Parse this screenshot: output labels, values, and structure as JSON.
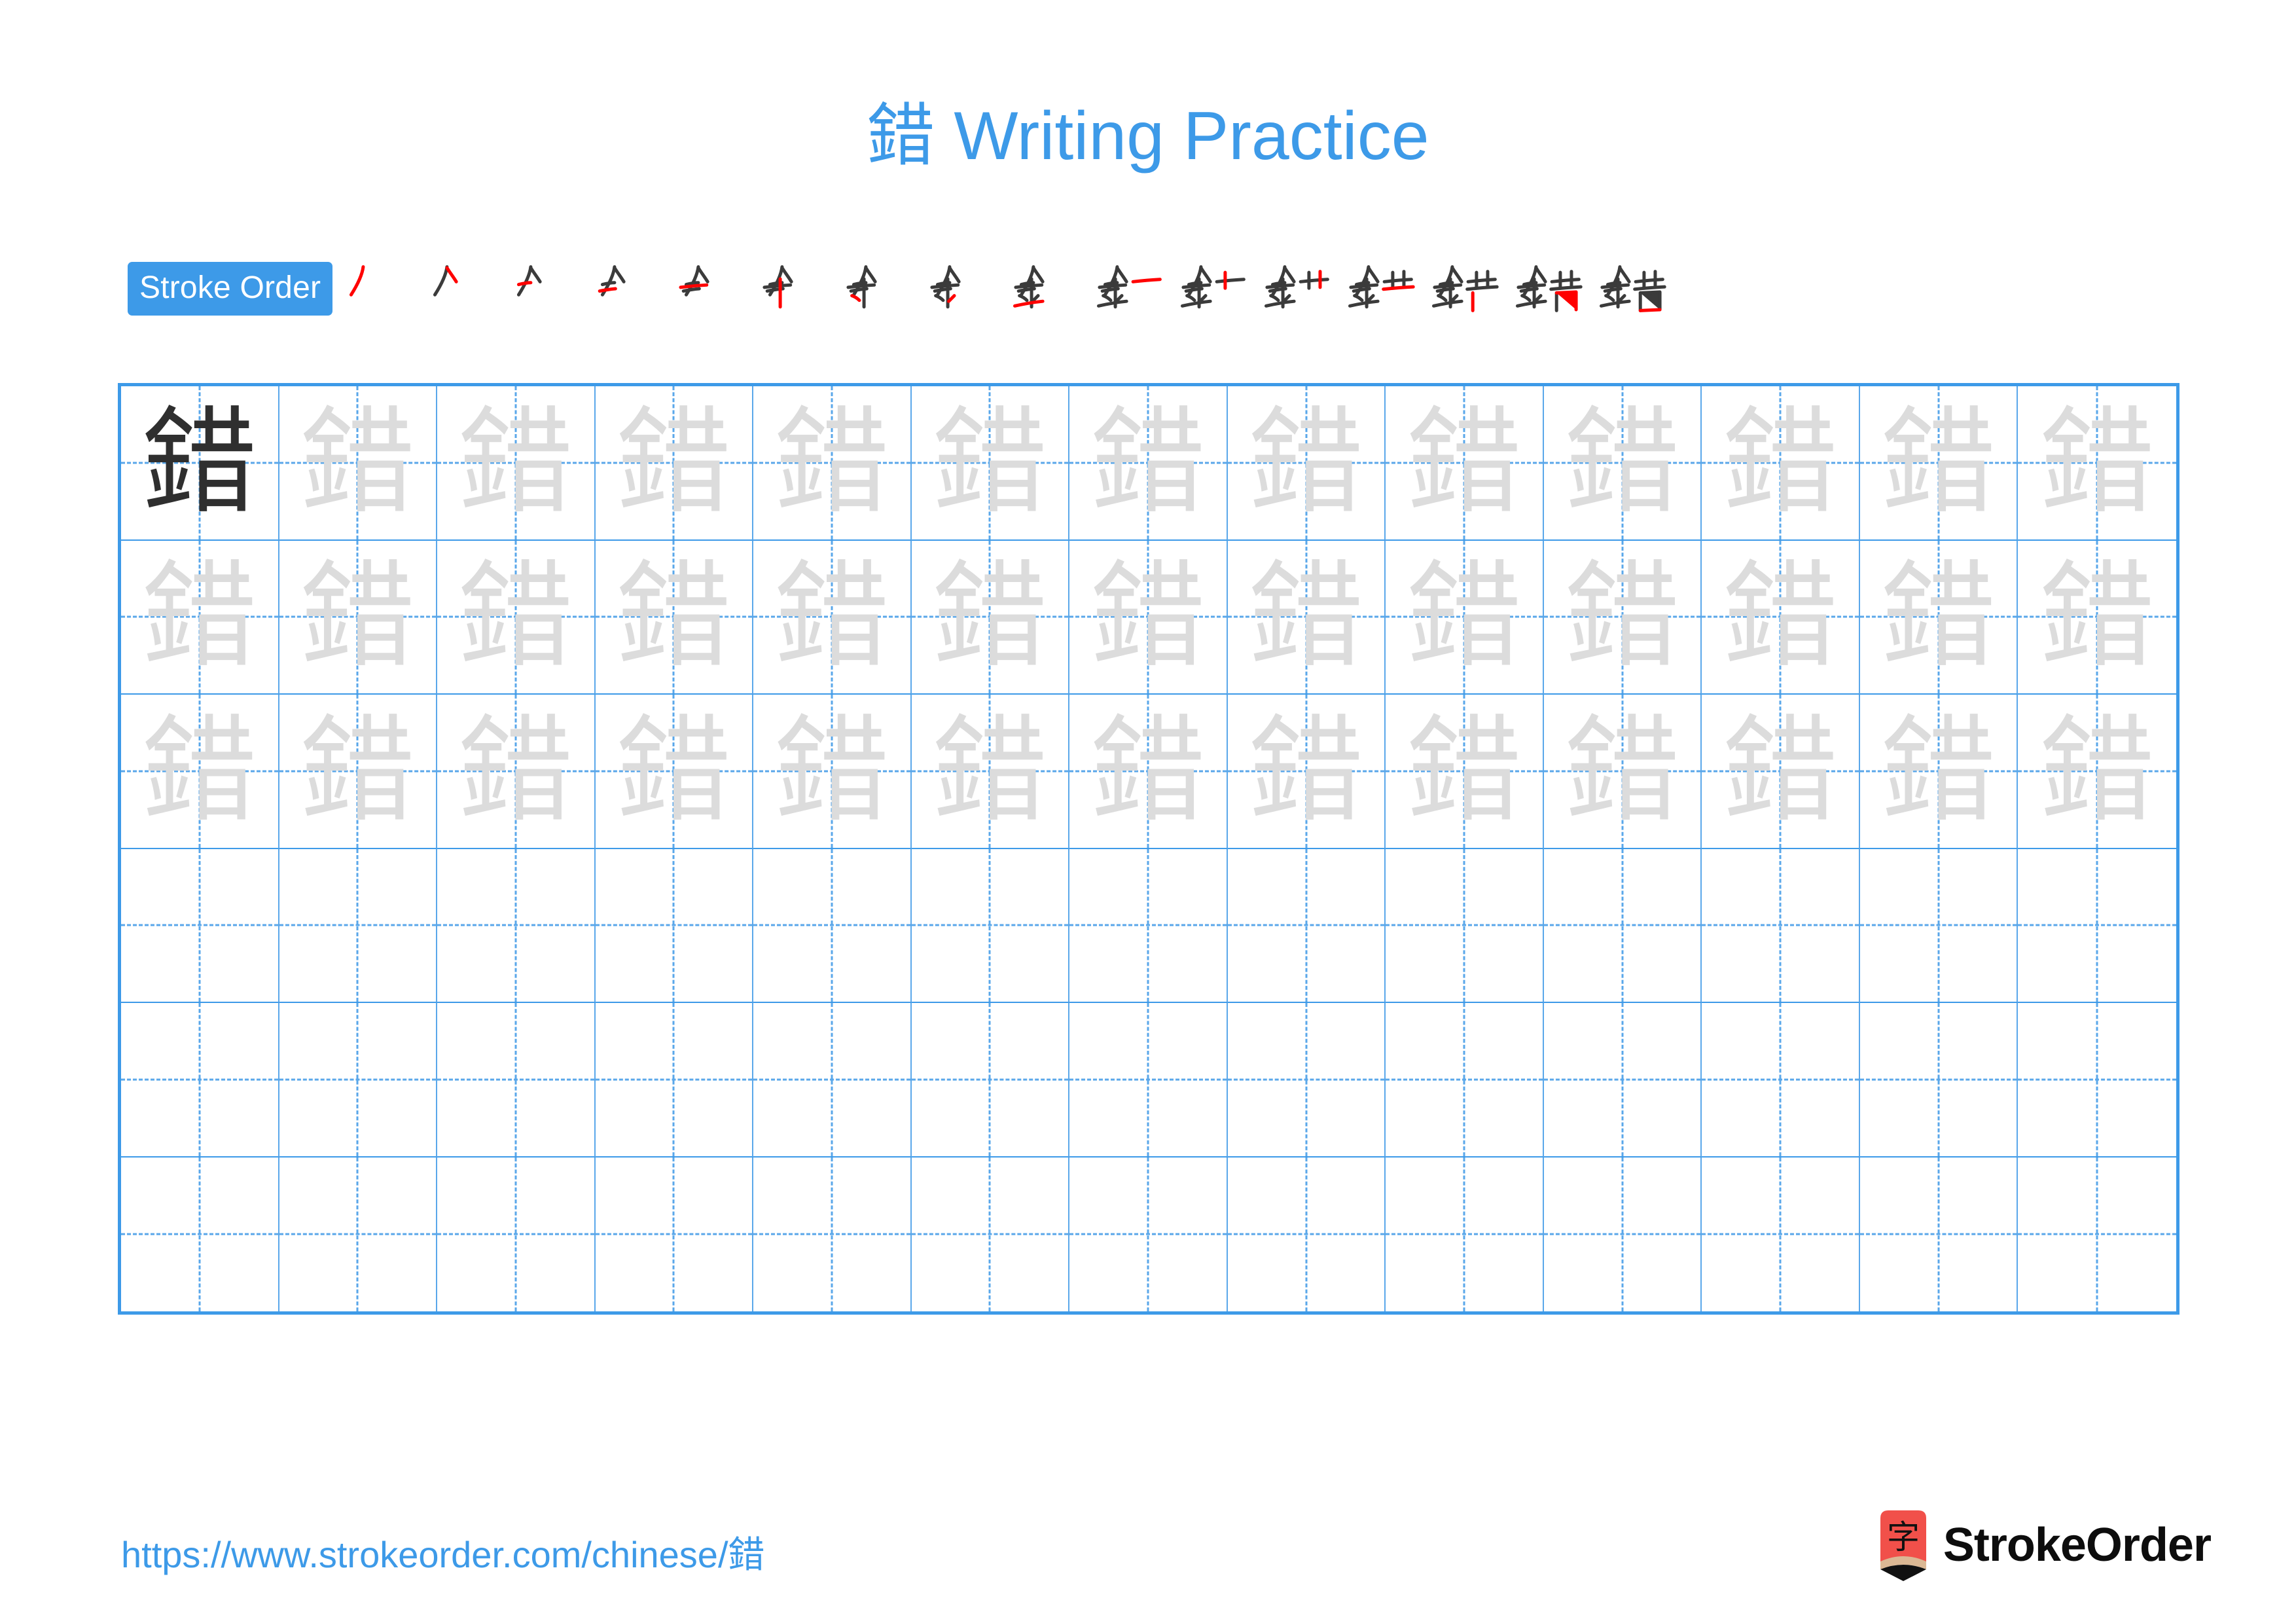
{
  "page": {
    "character": "錯",
    "background_color": "#ffffff",
    "accent_color": "#3d9ae8",
    "stroke_new_color": "#ff0000",
    "stroke_old_color": "#3b3b3b",
    "trace_color": "#dcdcdc",
    "model_color": "#2f2f2f"
  },
  "title": {
    "character": "錯",
    "text": " Writing Practice",
    "full": "錯 Writing Practice"
  },
  "stroke_order": {
    "badge_label": "Stroke Order",
    "total_strokes": 16,
    "steps": [
      {
        "index": 1,
        "glyph": "丿"
      },
      {
        "index": 2,
        "glyph": "𠂉"
      },
      {
        "index": 3,
        "glyph": "⺈"
      },
      {
        "index": 4,
        "glyph": "𠂇"
      },
      {
        "index": 5,
        "glyph": "牟"
      },
      {
        "index": 6,
        "glyph": "𠆢"
      },
      {
        "index": 7,
        "glyph": "朩"
      },
      {
        "index": 8,
        "glyph": "金"
      },
      {
        "index": 9,
        "glyph": "釒一"
      },
      {
        "index": 10,
        "glyph": "釒十"
      },
      {
        "index": 11,
        "glyph": "釒卄"
      },
      {
        "index": 12,
        "glyph": "釒艹"
      },
      {
        "index": 13,
        "glyph": "錯"
      },
      {
        "index": 14,
        "glyph": "錯"
      },
      {
        "index": 15,
        "glyph": "錯"
      },
      {
        "index": 16,
        "glyph": "錯"
      }
    ]
  },
  "grid": {
    "columns": 13,
    "rows": 6,
    "cells": [
      [
        "model",
        "trace",
        "trace",
        "trace",
        "trace",
        "trace",
        "trace",
        "trace",
        "trace",
        "trace",
        "trace",
        "trace",
        "trace"
      ],
      [
        "trace",
        "trace",
        "trace",
        "trace",
        "trace",
        "trace",
        "trace",
        "trace",
        "trace",
        "trace",
        "trace",
        "trace",
        "trace"
      ],
      [
        "trace",
        "trace",
        "trace",
        "trace",
        "trace",
        "trace",
        "trace",
        "trace",
        "trace",
        "trace",
        "trace",
        "trace",
        "trace"
      ],
      [
        "blank",
        "blank",
        "blank",
        "blank",
        "blank",
        "blank",
        "blank",
        "blank",
        "blank",
        "blank",
        "blank",
        "blank",
        "blank"
      ],
      [
        "blank",
        "blank",
        "blank",
        "blank",
        "blank",
        "blank",
        "blank",
        "blank",
        "blank",
        "blank",
        "blank",
        "blank",
        "blank"
      ],
      [
        "blank",
        "blank",
        "blank",
        "blank",
        "blank",
        "blank",
        "blank",
        "blank",
        "blank",
        "blank",
        "blank",
        "blank",
        "blank"
      ]
    ]
  },
  "footer": {
    "url": "https://www.strokeorder.com/chinese/錯",
    "logo_character": "字",
    "logo_wordmark": "StrokeOrder",
    "logo_color": "#f1504a",
    "logo_wood_color": "#dbb894"
  }
}
